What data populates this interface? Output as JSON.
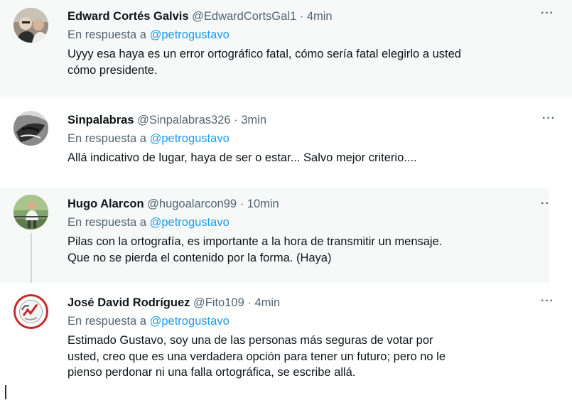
{
  "replies": [
    {
      "name": "Edward Cortés Galvis",
      "handle": "@EdwardCortsGal1",
      "time": "· 4min",
      "reply_prefix": "En respuesta a",
      "reply_to": "@petrogustavo",
      "text_lines": [
        "Uyyy esa haya es un error ortográfico fatal, cómo sería fatal elegirlo a usted",
        "cómo presidente."
      ],
      "more": "···"
    },
    {
      "name": "Sinpalabras",
      "handle": "@Sinpalabras326",
      "time": "· 3min",
      "reply_prefix": "En respuesta a",
      "reply_to": "@petrogustavo",
      "text_lines": [
        "Allá indicativo de lugar, haya de ser o estar... Salvo mejor criterio...."
      ],
      "more": "···"
    },
    {
      "name": "Hugo Alarcon",
      "handle": "@hugoalarcon99",
      "time": "· 10min",
      "reply_prefix": "En respuesta a",
      "reply_to": "@petrogustavo",
      "text_lines": [
        "Pilas con la ortografía, es importante a la hora de transmitir un mensaje.",
        "Que no se pierda el contenido por la forma. (Haya)"
      ],
      "more": "··"
    },
    {
      "name": "José David Rodríguez",
      "handle": "@Fito109",
      "time": "· 4min",
      "reply_prefix": "En respuesta a",
      "reply_to": "@petrogustavo",
      "text_lines": [
        "Estimado Gustavo, soy una de las personas más seguras de votar por",
        "usted, creo que es una verdadera opción para tener un futuro; pero no le",
        "pienso perdonar ni una falla ortográfica, se escribe allá."
      ],
      "more": "···"
    }
  ],
  "colors": {
    "mention": "#1d9bf0",
    "secondary_text": "#536471",
    "primary_text": "#0f1419"
  }
}
